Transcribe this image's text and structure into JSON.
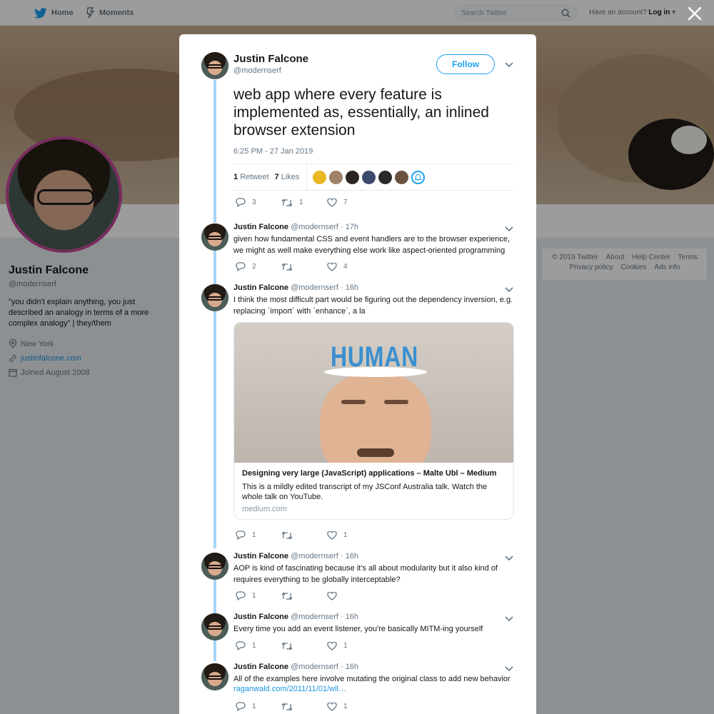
{
  "topbar": {
    "home_label": "Home",
    "moments_label": "Moments",
    "search_placeholder": "Search Twitter",
    "have_account": "Have an account?",
    "login_label": "Log in"
  },
  "profile": {
    "name": "Justin Falcone",
    "handle": "@modernserf",
    "bio": "\"you didn't explain anything, you just described an analogy in terms of a more complex analogy\" | they/them",
    "location": "New York",
    "website": "justinfalcone.com",
    "joined": "Joined August 2008"
  },
  "footer": {
    "copyright": "© 2019 Twitter",
    "about": "About",
    "help": "Help Center",
    "terms": "Terms",
    "privacy": "Privacy policy",
    "cookies": "Cookies",
    "ads": "Ads info"
  },
  "main_tweet": {
    "name": "Justin Falcone",
    "handle": "@modernserf",
    "follow_label": "Follow",
    "text": "web app where every feature is implemented as, essentially, an inlined browser extension",
    "timestamp": "6:25 PM - 27 Jan 2019",
    "retweet_count": "1",
    "retweet_label": "Retweet",
    "like_count": "7",
    "like_label": "Likes",
    "likers": [
      "#e8b923",
      "#a08066",
      "#2c2420",
      "#3b4a6b",
      "#2a2a2a",
      "#6b5142"
    ],
    "reply_count": "3",
    "rt_count": "1",
    "fav_count": "7"
  },
  "replies": [
    {
      "name": "Justin Falcone",
      "handle": "@modernserf",
      "time": "· 17h",
      "text": "given how fundamental CSS and event handlers are to the browser experience, we might as well make everything else work like aspect-oriented programming",
      "reply_count": "2",
      "rt_count": "",
      "fav_count": "4"
    },
    {
      "name": "Justin Falcone",
      "handle": "@modernserf",
      "time": "· 16h",
      "text": "I think the most difficult part would be figuring out the dependency inversion, e.g. replacing `import` with `enhance`, a la",
      "card": {
        "image_text": "HUMAN",
        "title": "Designing very large (JavaScript) applications – Malte Ubl – Medium",
        "description": "This is a mildly edited transcript of my JSConf Australia talk. Watch the whole talk on YouTube.",
        "domain": "medium.com"
      },
      "reply_count": "1",
      "rt_count": "",
      "fav_count": "1"
    },
    {
      "name": "Justin Falcone",
      "handle": "@modernserf",
      "time": "· 16h",
      "text": "AOP is kind of fascinating because it's all about modularity but it also kind of requires everything to be globally interceptable?",
      "reply_count": "1",
      "rt_count": "",
      "fav_count": ""
    },
    {
      "name": "Justin Falcone",
      "handle": "@modernserf",
      "time": "· 16h",
      "text": "Every time you add an event listener, you're basically MITM-ing yourself",
      "reply_count": "1",
      "rt_count": "",
      "fav_count": "1"
    },
    {
      "name": "Justin Falcone",
      "handle": "@modernserf",
      "time": "· 16h",
      "text": "All of the examples here involve mutating the original class to add new behavior",
      "link": "raganwald.com/2011/11/01/wil…",
      "reply_count": "1",
      "rt_count": "",
      "fav_count": "1"
    }
  ],
  "colors": {
    "accent": "#1da1f2",
    "thread_line": "#a5d4f7",
    "avatar_border": "#c4479a"
  }
}
